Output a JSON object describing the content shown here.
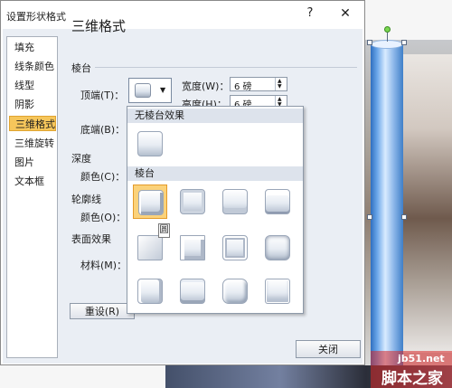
{
  "dialog": {
    "title": "设置形状格式",
    "help": "?",
    "close_glyph": "✕"
  },
  "nav": {
    "items": [
      "填充",
      "线条颜色",
      "线型",
      "阴影",
      "三维格式",
      "三维旋转",
      "图片",
      "文本框"
    ],
    "selected_index": 4
  },
  "panel": {
    "heading": "三维格式",
    "bevel_section": "棱台",
    "top_label": "顶端(T)：",
    "bottom_label": "底端(B)：",
    "width_label": "宽度(W)：",
    "width_value": "6 磅",
    "height_label": "高度(H)：",
    "height_value": "6 磅",
    "depth_section": "深度",
    "depth_color_label": "颜色(C)：",
    "contour_section": "轮廓线",
    "contour_color_label": "颜色(O)：",
    "surface_section": "表面效果",
    "material_label": "材料(M)：",
    "reset_button": "重设(R)",
    "close_button": "关闭"
  },
  "gallery": {
    "no_bevel_header": "无棱台效果",
    "bevel_header": "棱台",
    "tooltip": "圆",
    "selected_index": 0
  },
  "watermark": {
    "line1": "jb51.net",
    "line2": "脚本之家"
  },
  "colors": {
    "selected_nav": "#f6c65b",
    "selected_cell": "#fbd27a",
    "client_bg": "#eaeef4"
  }
}
